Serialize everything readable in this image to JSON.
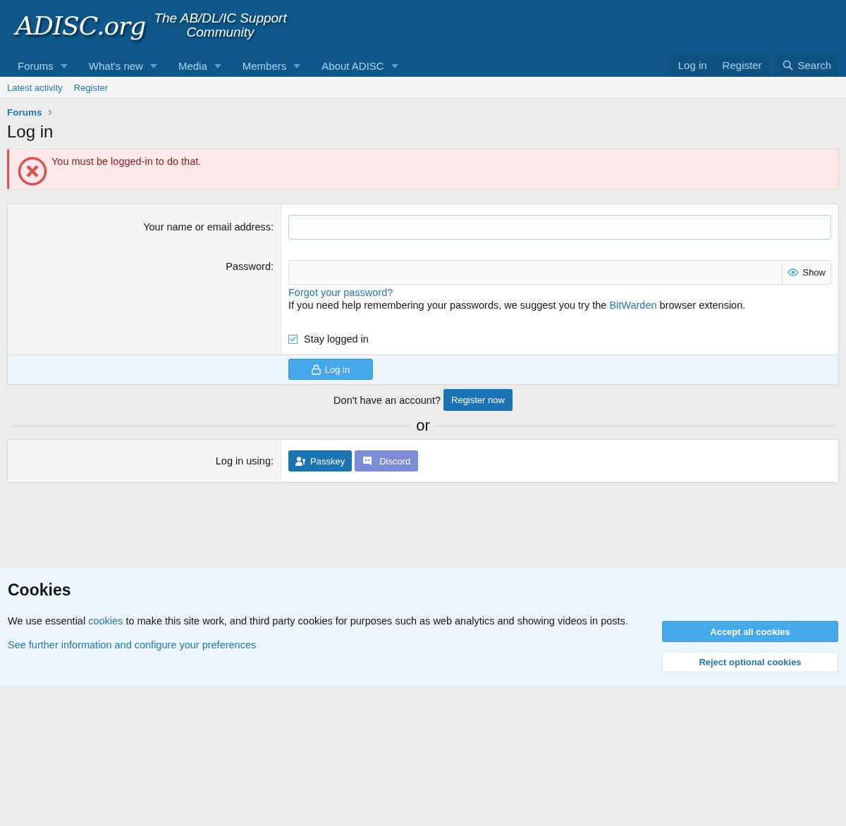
{
  "header": {
    "logo": "ADISC.org",
    "tagline_line1": "The AB/DL/IC Support",
    "tagline_line2": "Community"
  },
  "nav": [
    {
      "label": "Forums",
      "dropdown": true,
      "selected": false
    },
    {
      "label": "What's new",
      "dropdown": true,
      "selected": false
    },
    {
      "label": "Media",
      "dropdown": true,
      "selected": false
    },
    {
      "label": "Members",
      "dropdown": true,
      "selected": false
    },
    {
      "label": "About ADISC",
      "dropdown": true,
      "selected": false
    }
  ],
  "account_nav": {
    "login": "Log in",
    "register": "Register",
    "search": "Search"
  },
  "sub_nav": [
    "Latest activity",
    "Register"
  ],
  "breadcrumb": [
    "Forums"
  ],
  "page_title": "Log in",
  "error": "You must be logged-in to do that.",
  "form": {
    "name_label": "Your name or email address:",
    "password_label": "Password:",
    "show": "Show",
    "forgot": "Forgot your password?",
    "help_before": "If you need help remembering your passwords, we suggest you try the ",
    "help_link": "BitWarden",
    "help_after": " browser extension.",
    "stay_logged_in": {
      "label": "Stay logged in",
      "checked": true
    },
    "submit": "Log in"
  },
  "register": {
    "prompt": "Don't have an account?",
    "button": "Register now"
  },
  "divider": "or",
  "providers": {
    "label": "Log in using:",
    "buttons": [
      {
        "label": "Passkey",
        "kind": "passkey"
      },
      {
        "label": "Discord",
        "kind": "discord"
      }
    ]
  },
  "cookies": {
    "title": "Cookies",
    "before": "We use essential ",
    "link": "cookies",
    "after": " to make this site work, and third party cookies for purposes such as web analytics and showing videos in posts.",
    "more": "See further information and configure your preferences",
    "accept": "Accept all cookies",
    "reject": "Reject optional cookies"
  }
}
